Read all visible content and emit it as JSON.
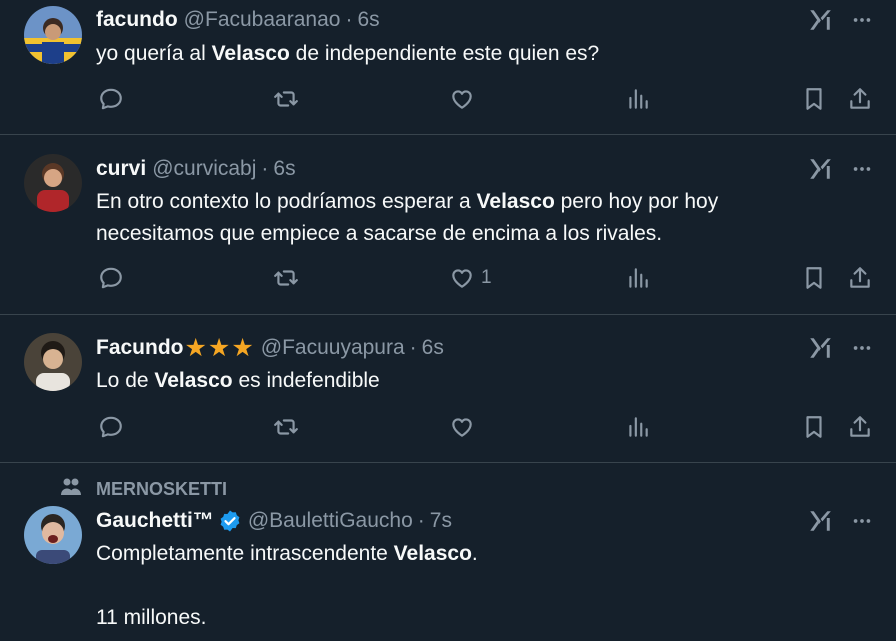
{
  "tweets": [
    {
      "name": "facundo",
      "handle": "@Facubaaranao",
      "dot": "·",
      "time": "6s",
      "text_parts": [
        "yo quería al ",
        "Velasco",
        " de independiente este quien es?"
      ],
      "like_count": ""
    },
    {
      "name": "curvi",
      "handle": "@curvicabj",
      "dot": "·",
      "time": "6s",
      "text_parts": [
        "En otro contexto lo podríamos esperar a ",
        "Velasco",
        " pero hoy por hoy",
        "necesitamos que empiece a sacarse de encima a los rivales."
      ],
      "like_count": "1"
    },
    {
      "name": "Facundo",
      "handle": "@Facuuyapura",
      "dot": "·",
      "time": "6s",
      "stars": [
        "★",
        "★",
        "★"
      ],
      "text_parts": [
        "Lo de ",
        "Velasco",
        " es indefendible"
      ],
      "like_count": ""
    },
    {
      "social_context": "MERNOSKETTI",
      "name": "Gauchetti™",
      "handle": "@BaulettiGaucho",
      "dot": "·",
      "time": "7s",
      "verified": true,
      "text_parts": [
        "Completamente intrascendente ",
        "Velasco",
        ".",
        "11 millones."
      ]
    }
  ],
  "colors": {
    "background": "#15202b",
    "text": "#f7f9f9",
    "secondary": "#8b98a5",
    "divider": "#38444d",
    "verified": "#1d9bf0",
    "stars": "#f5a623"
  },
  "icons": [
    "reply-icon",
    "retweet-icon",
    "like-icon",
    "views-icon",
    "bookmark-icon",
    "share-icon",
    "grok-icon",
    "more-icon",
    "community-icon",
    "verified-badge-icon",
    "star-icon"
  ]
}
